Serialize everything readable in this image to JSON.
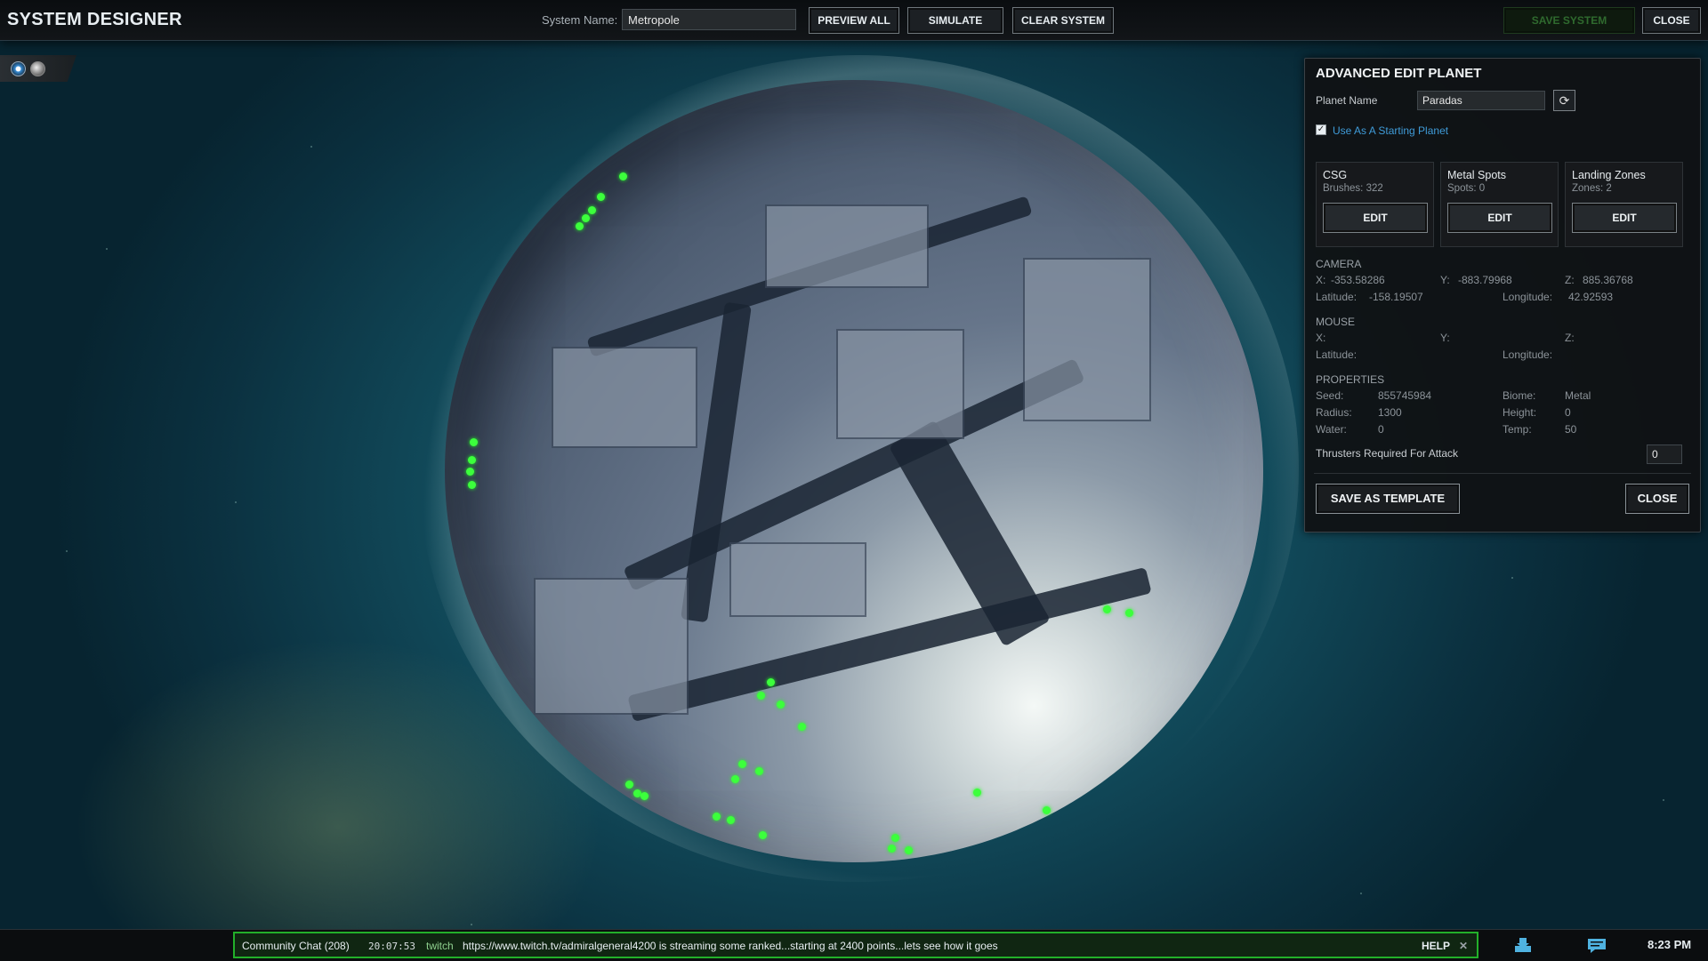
{
  "topbar": {
    "title": "SYSTEM DESIGNER",
    "system_name_label": "System Name:",
    "system_name_value": "Metropole",
    "preview_all": "PREVIEW ALL",
    "simulate": "SIMULATE",
    "clear_system": "CLEAR SYSTEM",
    "save_system": "SAVE SYSTEM",
    "close": "CLOSE"
  },
  "panel": {
    "title": "ADVANCED EDIT PLANET",
    "planet_name_label": "Planet Name",
    "planet_name_value": "Paradas",
    "refresh_icon": "refresh-icon",
    "starting_planet_checked": true,
    "starting_planet_label": "Use As A Starting Planet",
    "cards": [
      {
        "title": "CSG",
        "stat": "Brushes: 322",
        "button": "EDIT"
      },
      {
        "title": "Metal Spots",
        "stat": "Spots: 0",
        "button": "EDIT"
      },
      {
        "title": "Landing Zones",
        "stat": "Zones: 2",
        "button": "EDIT"
      }
    ],
    "camera": {
      "heading": "CAMERA",
      "x_label": "X:",
      "x": "-353.58286",
      "y_label": "Y:",
      "y": "-883.79968",
      "z_label": "Z:",
      "z": "885.36768",
      "lat_label": "Latitude:",
      "lat": "-158.19507",
      "lon_label": "Longitude:",
      "lon": "42.92593"
    },
    "mouse": {
      "heading": "MOUSE",
      "x_label": "X:",
      "y_label": "Y:",
      "z_label": "Z:",
      "lat_label": "Latitude:",
      "lon_label": "Longitude:"
    },
    "properties": {
      "heading": "PROPERTIES",
      "seed_label": "Seed:",
      "seed": "855745984",
      "radius_label": "Radius:",
      "radius": "1300",
      "water_label": "Water:",
      "water": "0",
      "biome_label": "Biome:",
      "biome": "Metal",
      "height_label": "Height:",
      "height": "0",
      "temp_label": "Temp:",
      "temp": "50"
    },
    "thrusters_label": "Thrusters Required For Attack",
    "thrusters_value": "0",
    "save_template": "SAVE AS TEMPLATE",
    "close": "CLOSE"
  },
  "chat": {
    "label": "Community Chat (208)",
    "time": "20:07:53",
    "source": "twitch",
    "message": "https://www.twitch.tv/admiralgeneral4200 is streaming some ranked...starting at 2400 points...lets see how it goes",
    "help": "HELP",
    "close_glyph": "✕"
  },
  "tray": {
    "icons": [
      "download-icon",
      "message-icon"
    ],
    "clock": "8:23 PM"
  },
  "colors": {
    "accent_link": "#3f9bd8",
    "chat_border": "#22b02a",
    "marker_green": "#3cff3c"
  }
}
